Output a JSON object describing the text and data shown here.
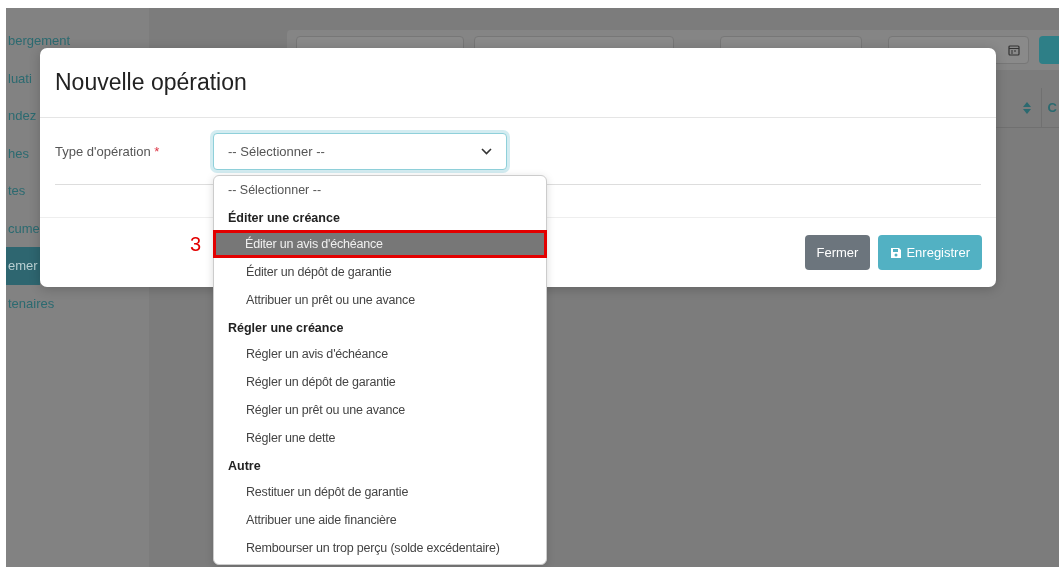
{
  "sidebar": {
    "items": [
      {
        "label": "bergement",
        "selected": false
      },
      {
        "label": "luati",
        "selected": false
      },
      {
        "label": "ndez",
        "selected": false
      },
      {
        "label": "hes",
        "selected": false
      },
      {
        "label": "tes",
        "selected": false
      },
      {
        "label": "cume",
        "selected": false
      },
      {
        "label": "emer",
        "selected": true
      },
      {
        "label": "tenaires",
        "selected": false
      }
    ]
  },
  "table": {
    "columns": [
      "C"
    ]
  },
  "modal": {
    "title": "Nouvelle opération",
    "field": {
      "label": "Type d'opération",
      "required_mark": "*",
      "value": "-- Sélectionner --",
      "expanded": true
    },
    "options": [
      {
        "kind": "placeholder",
        "label": "-- Sélectionner --"
      },
      {
        "kind": "group",
        "label": "Éditer une créance",
        "children": [
          {
            "label": "Éditer un avis d'échéance",
            "selected": true,
            "annotated": true
          },
          {
            "label": "Éditer un dépôt de garantie",
            "selected": false,
            "annotated": false
          },
          {
            "label": "Attribuer un prêt ou une avance",
            "selected": false,
            "annotated": false
          }
        ]
      },
      {
        "kind": "group",
        "label": "Régler une créance",
        "children": [
          {
            "label": "Régler un avis d'échéance",
            "selected": false,
            "annotated": false
          },
          {
            "label": "Régler un dépôt de garantie",
            "selected": false,
            "annotated": false
          },
          {
            "label": "Régler un prêt ou une avance",
            "selected": false,
            "annotated": false
          },
          {
            "label": "Régler une dette",
            "selected": false,
            "annotated": false
          }
        ]
      },
      {
        "kind": "group",
        "label": "Autre",
        "children": [
          {
            "label": "Restituer un dépôt de garantie",
            "selected": false,
            "annotated": false
          },
          {
            "label": "Attribuer une aide financière",
            "selected": false,
            "annotated": false
          },
          {
            "label": "Rembourser un trop perçu (solde excédentaire)",
            "selected": false,
            "annotated": false
          }
        ]
      }
    ],
    "buttons": [
      {
        "label": "Fermer",
        "kind": "secondary"
      },
      {
        "label": "Enregistrer",
        "kind": "primary"
      }
    ]
  },
  "annotation": {
    "label": "3"
  }
}
